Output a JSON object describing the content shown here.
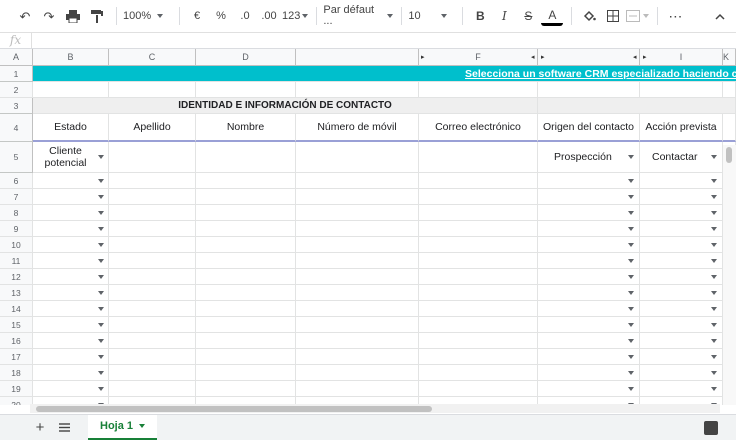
{
  "toolbar": {
    "zoom": "100%",
    "currency": "€",
    "percent": "%",
    "dec_decrease": ".0",
    "dec_increase": ".00",
    "more_formats": "123",
    "font": "Par défaut ...",
    "font_size": "10",
    "bold": "B",
    "italic": "I",
    "strike": "S",
    "text_color": "A",
    "more": "⋯"
  },
  "formula_bar": {
    "fx": "fx",
    "value": ""
  },
  "columns": [
    "A",
    "B",
    "C",
    "D",
    "",
    "F",
    "",
    "I",
    "K"
  ],
  "rows": [
    "1",
    "2",
    "3",
    "4",
    "5",
    "6",
    "7",
    "8",
    "9",
    "10",
    "11",
    "12",
    "13",
    "14",
    "15",
    "16",
    "17",
    "18",
    "19",
    "20"
  ],
  "banner": {
    "text": "Selecciona un software CRM especializado haciendo cl",
    "color": "#00bfcc"
  },
  "section": {
    "title": "IDENTIDAD E INFORMACIÓN DE CONTACTO"
  },
  "headers": [
    "Estado",
    "Apellido",
    "Nombre",
    "Número de móvil",
    "Correo electrónico",
    "Origen del contacto",
    "Acción prevista"
  ],
  "row5": {
    "estado": "Cliente potencial",
    "origen": "Prospección",
    "accion": "Contactar"
  },
  "sheet": {
    "tab": "Hoja 1"
  }
}
